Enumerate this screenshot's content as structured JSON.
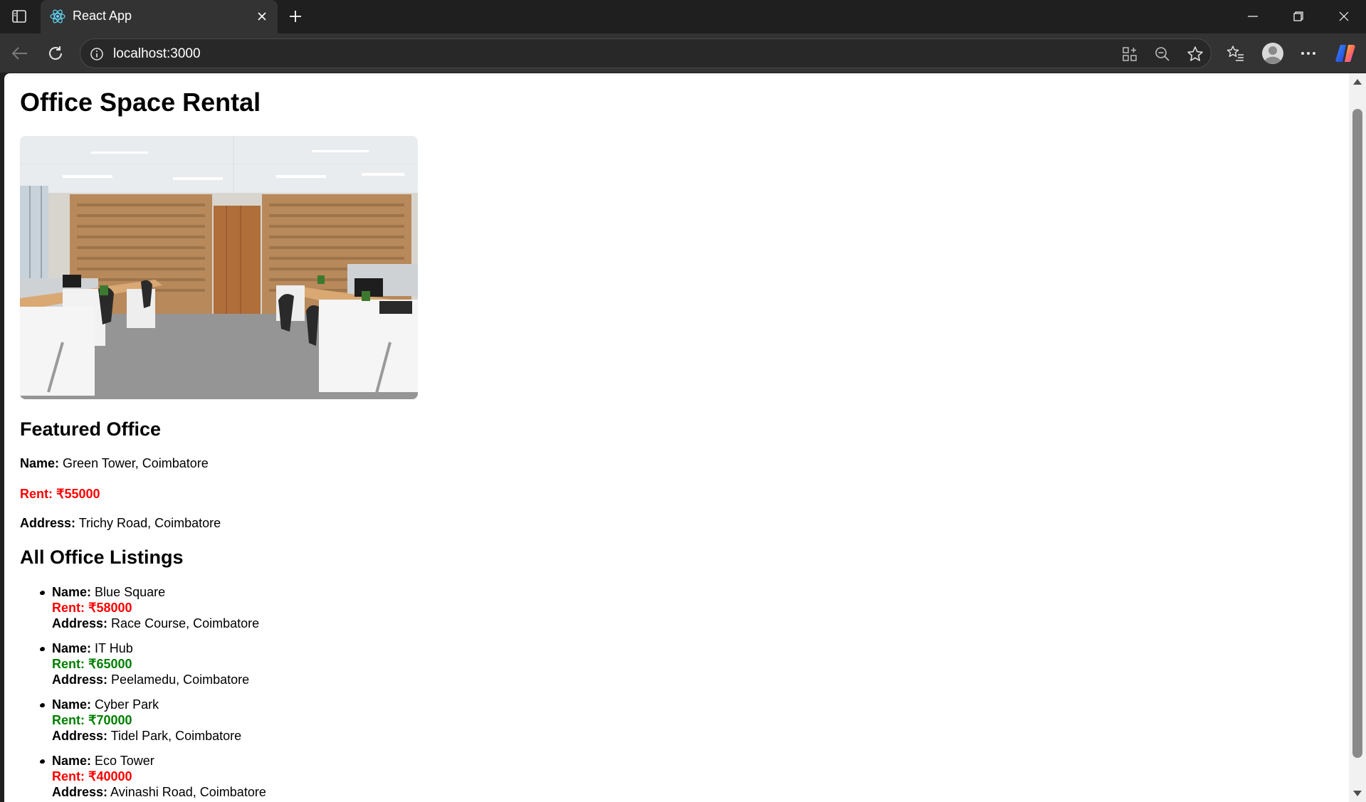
{
  "browser": {
    "tab_title": "React App",
    "url": "localhost:3000"
  },
  "page": {
    "title": "Office Space Rental",
    "image_alt": "Office Space",
    "featured": {
      "heading": "Featured Office",
      "name_label": "Name:",
      "name": "Green Tower, Coimbatore",
      "rent_label": "Rent:",
      "rent": "₹55000",
      "rent_color": "#ff0000",
      "address_label": "Address:",
      "address": "Trichy Road, Coimbatore"
    },
    "listings_heading": "All Office Listings",
    "listings": [
      {
        "name_label": "Name:",
        "name": "Blue Square",
        "rent_label": "Rent:",
        "rent": "₹58000",
        "rent_color": "#ff0000",
        "address_label": "Address:",
        "address": "Race Course, Coimbatore"
      },
      {
        "name_label": "Name:",
        "name": "IT Hub",
        "rent_label": "Rent:",
        "rent": "₹65000",
        "rent_color": "#008000",
        "address_label": "Address:",
        "address": "Peelamedu, Coimbatore"
      },
      {
        "name_label": "Name:",
        "name": "Cyber Park",
        "rent_label": "Rent:",
        "rent": "₹70000",
        "rent_color": "#008000",
        "address_label": "Address:",
        "address": "Tidel Park, Coimbatore"
      },
      {
        "name_label": "Name:",
        "name": "Eco Tower",
        "rent_label": "Rent:",
        "rent": "₹40000",
        "rent_color": "#ff0000",
        "address_label": "Address:",
        "address": "Avinashi Road, Coimbatore"
      }
    ]
  }
}
